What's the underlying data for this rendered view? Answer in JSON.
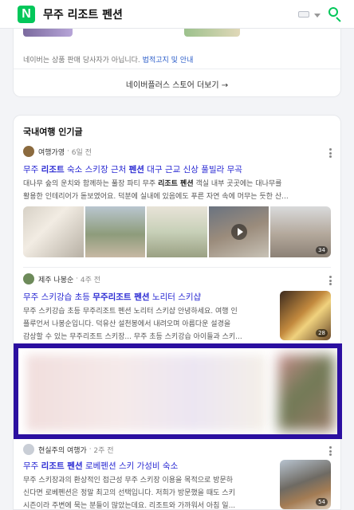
{
  "header": {
    "logo": "N",
    "query": "무주 리조트 펜션"
  },
  "store_card": {
    "notice_prefix": "네이버는 상품 판매 당사자가 아닙니다.",
    "notice_link": "법적고지 및 안내",
    "more_label": "네이버플러스 스토어 더보기 →"
  },
  "popular": {
    "section_title": "국내여행 인기글",
    "posts": [
      {
        "author": "여행가영",
        "time": "6일 전",
        "title_pre": "무주 ",
        "title_bold1": "리조트",
        "title_mid": " 숙소 스키장 근처 ",
        "title_bold2": "펜션",
        "title_post": " 대구 근교 신상 풀빌라 무곡",
        "snippet_l1_a": "대나무 숲의 운치와 함께하는 풀장 파티 무주 ",
        "snippet_l1_b": "리조트 펜션",
        "snippet_l1_c": " 객실 내부 곳곳에는 대나무를",
        "snippet_l2": "활용한 인테리어가 돋보였어요. 덕분에 실내에 있음에도 푸른 자연 속에 머무는 듯한 산...",
        "image_count": "34"
      },
      {
        "author": "제주 나봉순",
        "time": "4주 전",
        "title_pre": "무주 스키강습 초등 ",
        "title_bold1": "무주리조트 펜션",
        "title_post": " 노리터 스키샵",
        "snippet_l1": "무주 스키강습 초등 무주리조트 펜션 노리터 스키샵 안녕하세요. 여행 인",
        "snippet_l2": "플루언서 나봉순입니다. 덕유산 설천봉에서 내려오며 아름다운 설경을",
        "snippet_l3": "감상할 수 있는 무주리조트 스키장... 무주 초등 스키강습 아이들과 스키...",
        "image_count": "28"
      },
      {
        "author": "현실주의 여행가",
        "time": "2주 전",
        "title_pre": "무주 ",
        "title_bold1": "리조트 펜션",
        "title_post": " 로베펜션 스키 가성비 숙소",
        "snippet_l1": "무주 스키장과의 환상적인 접근성 무주 스키장 이용을 목적으로 방문하",
        "snippet_l2": "신다면 로베펜션은 정말 최고의 선택입니다. 저희가 방문했을 때도 스키",
        "snippet_l3": "시즌이라 주변에 묵는 분들이 많았는데요. 리조트와 가까워서 아침 일...",
        "image_count": "54"
      }
    ]
  },
  "colors": {
    "brand": "#03c75a",
    "link": "#2b2bd3",
    "ad_border": "#2b0fa0"
  }
}
